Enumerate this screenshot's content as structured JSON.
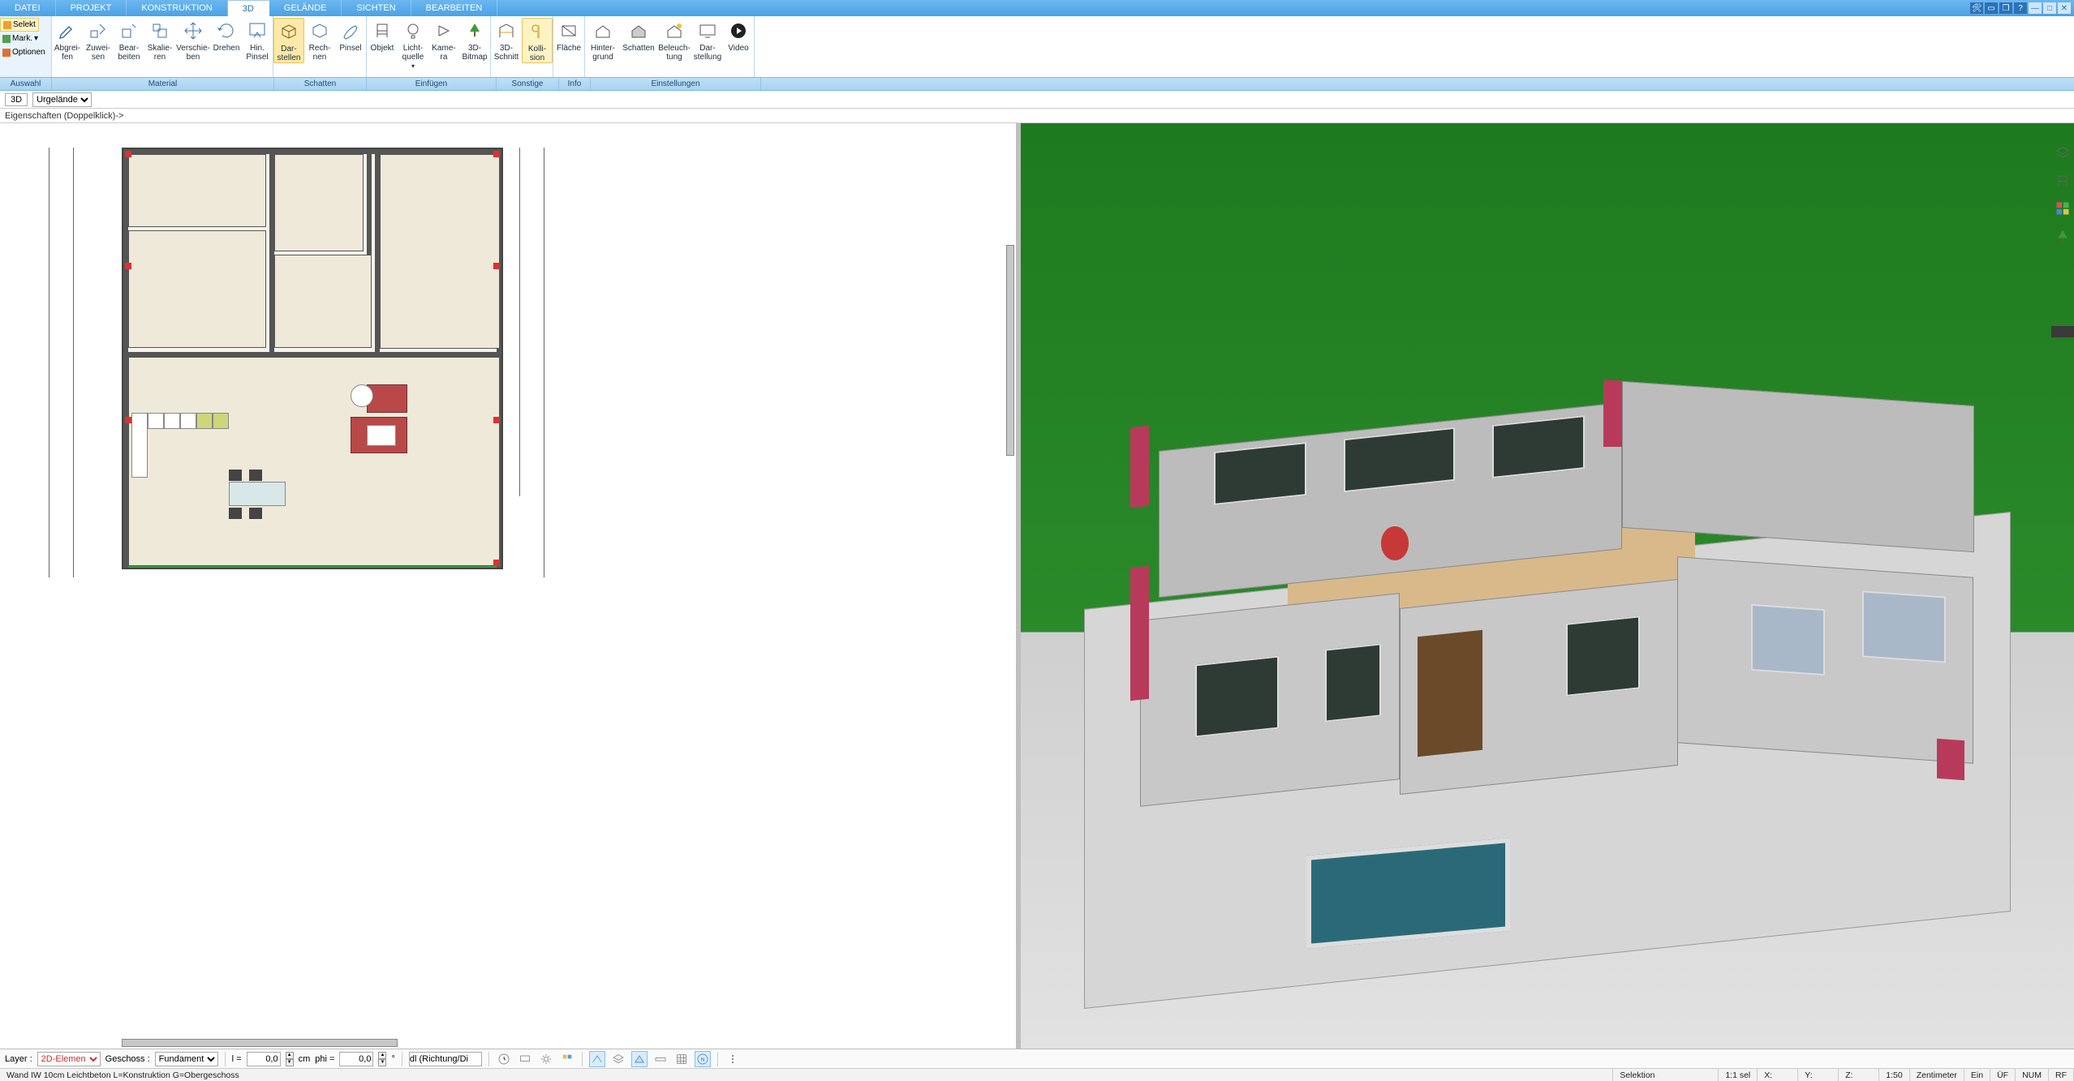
{
  "tabs": [
    "DATEI",
    "PROJEKT",
    "KONSTRUKTION",
    "3D",
    "GELÄNDE",
    "SICHTEN",
    "BEARBEITEN"
  ],
  "active_tab_index": 3,
  "win_icons": [
    "tools-icon",
    "screen-icon",
    "window-icon",
    "help-icon",
    "minimize-icon",
    "maximize-icon",
    "close-icon"
  ],
  "selection_panel": {
    "selekt": "Selekt",
    "mark": "Mark.",
    "optionen": "Optionen"
  },
  "ribbon_buttons": {
    "abgreifen": "Abgrei-\nfen",
    "zuweisen": "Zuwei-\nsen",
    "bearbeiten": "Bear-\nbeiten",
    "skalieren": "Skalie-\nren",
    "verschieben": "Verschie-\nben",
    "drehen": "Drehen",
    "hinpinsel": "Hin.\nPinsel",
    "darstellen": "Dar-\nstellen",
    "rechnen": "Rech-\nnen",
    "pinsel": "Pinsel",
    "objekt": "Objekt",
    "lichtquelle": "Licht-\nquelle",
    "kamera": "Kame-\nra",
    "baum": "3D-\nBitmap",
    "schnitt": "3D-\nSchnitt",
    "kollision": "Kolli-\nsion",
    "flaeche": "Fläche",
    "hintergrund": "Hinter-\ngrund",
    "schatten": "Schatten",
    "beleuchtung": "Beleuch-\ntung",
    "darstellung": "Dar-\nstellung",
    "video": "Video"
  },
  "group_labels": {
    "auswahl": "Auswahl",
    "material": "Material",
    "schatten": "Schatten",
    "einfuegen": "Einfügen",
    "sonstige": "Sonstige",
    "info": "Info",
    "einstellungen": "Einstellungen"
  },
  "subbar1": {
    "mode": "3D",
    "terrain": "Urgelände"
  },
  "subbar2": {
    "label": "Eigenschaften (Doppelklick)->"
  },
  "bottom": {
    "layer_label": "Layer :",
    "layer_value": "2D-Elemen",
    "geschoss_label": "Geschoss :",
    "geschoss_value": "Fundament",
    "l_label": "l =",
    "l_value": "0,0",
    "l_unit": "cm",
    "phi_label": "phi =",
    "phi_value": "0,0",
    "phi_unit": "°",
    "dl_value": "dl (Richtung/Di"
  },
  "status": {
    "left": "Wand IW 10cm Leichtbeton L=Konstruktion G=Obergeschoss",
    "selektion": "Selektion",
    "sel": "1:1 sel",
    "x": "X:",
    "y": "Y:",
    "z": "Z:",
    "scale": "1:50",
    "unit": "Zentimeter",
    "ein": "Ein",
    "uf": "ÜF",
    "num": "NUM",
    "rf": "RF"
  },
  "vtools": [
    "layers-icon",
    "chair-icon",
    "colors-icon",
    "tree-icon"
  ]
}
